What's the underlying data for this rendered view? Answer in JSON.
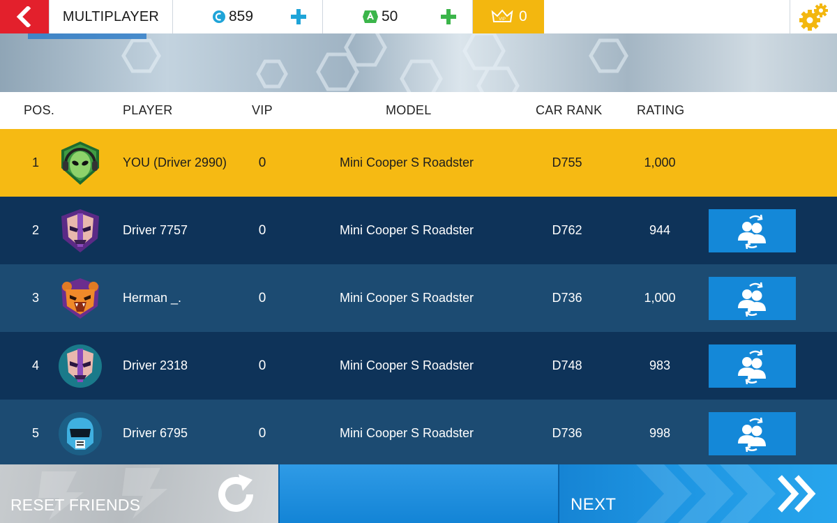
{
  "topbar": {
    "mode_label": "MULTIPLAYER",
    "credits_amount": "859",
    "tokens_amount": "50",
    "vip_badge": "VIP",
    "vip_amount": "0"
  },
  "table": {
    "headers": {
      "pos": "POS.",
      "player": "PLAYER",
      "vip": "VIP",
      "model": "MODEL",
      "car_rank": "CAR RANK",
      "rating": "RATING"
    },
    "rows": [
      {
        "pos": "1",
        "avatar": "alien-headphones-icon",
        "player": "YOU (Driver 2990)",
        "vip": "0",
        "model": "Mini Cooper S Roadster",
        "car_rank": "D755",
        "rating": "1,000",
        "is_you": true
      },
      {
        "pos": "2",
        "avatar": "purple-mask-icon",
        "player": "Driver 7757",
        "vip": "0",
        "model": "Mini Cooper S Roadster",
        "car_rank": "D762",
        "rating": "944",
        "is_you": false
      },
      {
        "pos": "3",
        "avatar": "bear-icon",
        "player": "Herman _.",
        "vip": "0",
        "model": "Mini Cooper S Roadster",
        "car_rank": "D736",
        "rating": "1,000",
        "is_you": false
      },
      {
        "pos": "4",
        "avatar": "purple-mask-icon",
        "player": "Driver 2318",
        "vip": "0",
        "model": "Mini Cooper S Roadster",
        "car_rank": "D748",
        "rating": "983",
        "is_you": false
      },
      {
        "pos": "5",
        "avatar": "robot-helmet-icon",
        "player": "Driver 6795",
        "vip": "0",
        "model": "Mini Cooper S Roadster",
        "car_rank": "D736",
        "rating": "998",
        "is_you": false
      }
    ]
  },
  "footer": {
    "reset_label": "RESET FRIENDS",
    "next_label": "NEXT"
  },
  "colors": {
    "you_row": "#f6ba13",
    "row_dark": "#0e3359",
    "row_light": "#1c4b72",
    "action_blue": "#1488d8",
    "back_red": "#e3202c",
    "vip_gold": "#f3b70f"
  }
}
